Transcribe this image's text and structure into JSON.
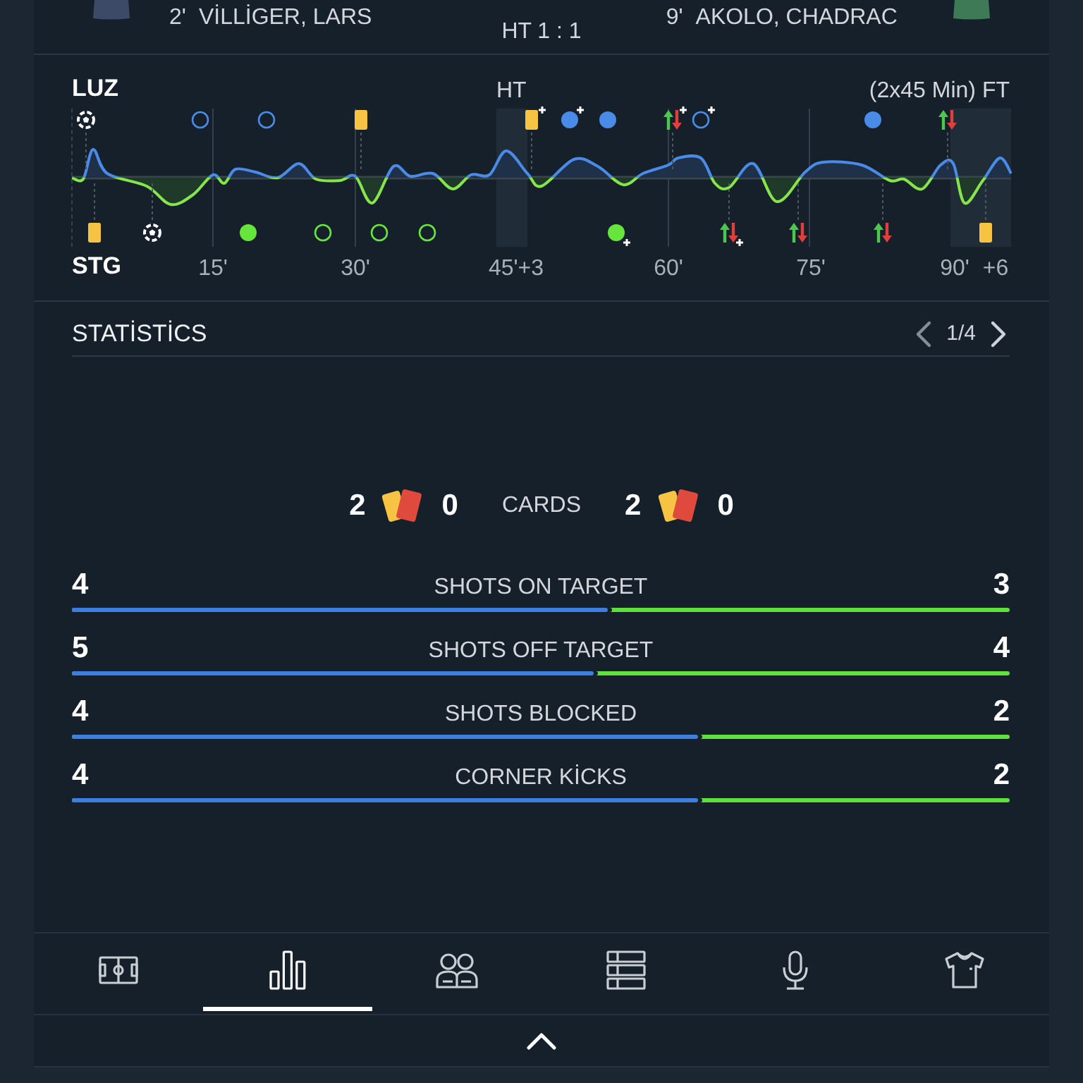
{
  "header": {
    "home_scorer": {
      "minute": "2'",
      "name": "VİLLİGER, LARS"
    },
    "score": "HT 1 : 1",
    "away_scorer": {
      "minute": "9'",
      "name": "AKOLO, CHADRAC"
    }
  },
  "timeline": {
    "home_team": "LUZ",
    "away_team": "STG",
    "half_time_label": "HT",
    "full_time_label": "(2x45 Min) FT",
    "ticks": [
      "15'",
      "30'",
      "45'+3",
      "60'",
      "75'",
      "90'",
      "+6"
    ],
    "home_events": [
      {
        "kind": "goal",
        "plus": false
      },
      {
        "kind": "hollow_circle",
        "plus": false
      },
      {
        "kind": "hollow_circle",
        "plus": false
      },
      {
        "kind": "card",
        "plus": false
      },
      {
        "kind": "card",
        "plus": true
      },
      {
        "kind": "filled_circle",
        "plus": true
      },
      {
        "kind": "filled_circle",
        "plus": false
      },
      {
        "kind": "substitution",
        "plus": true
      },
      {
        "kind": "hollow_circle",
        "plus": true
      },
      {
        "kind": "filled_circle",
        "plus": false
      },
      {
        "kind": "substitution",
        "plus": false
      }
    ],
    "away_events": [
      {
        "kind": "card",
        "plus": false
      },
      {
        "kind": "goal",
        "plus": false
      },
      {
        "kind": "filled_circle",
        "plus": false
      },
      {
        "kind": "hollow_circle",
        "plus": false
      },
      {
        "kind": "hollow_circle",
        "plus": false
      },
      {
        "kind": "hollow_circle",
        "plus": false
      },
      {
        "kind": "filled_circle",
        "plus": true
      },
      {
        "kind": "substitution",
        "plus": true
      },
      {
        "kind": "substitution",
        "plus": false
      },
      {
        "kind": "substitution",
        "plus": false
      },
      {
        "kind": "card",
        "plus": false
      }
    ]
  },
  "statistics": {
    "title": "STATİSTİCS",
    "pager": {
      "label": "1/4",
      "prev_disabled": true,
      "next_disabled": false
    },
    "cards": {
      "home_yellow": "2",
      "home_red": "0",
      "label": "CARDS",
      "away_yellow": "2",
      "away_red": "0"
    },
    "rows": [
      {
        "home": "4",
        "label": "SHOTS ON TARGET",
        "away": "3",
        "level": 0.571
      },
      {
        "home": "5",
        "label": "SHOTS OFF TARGET",
        "away": "4",
        "level": 0.556
      },
      {
        "home": "4",
        "label": "SHOTS BLOCKED",
        "away": "2",
        "level": 0.667
      },
      {
        "home": "4",
        "label": "CORNER KİCKS",
        "away": "2",
        "level": 0.667
      }
    ]
  },
  "tabs": [
    {
      "selected": false
    },
    {
      "selected": true
    },
    {
      "selected": false
    },
    {
      "selected": false
    },
    {
      "selected": false
    },
    {
      "selected": false
    }
  ]
}
